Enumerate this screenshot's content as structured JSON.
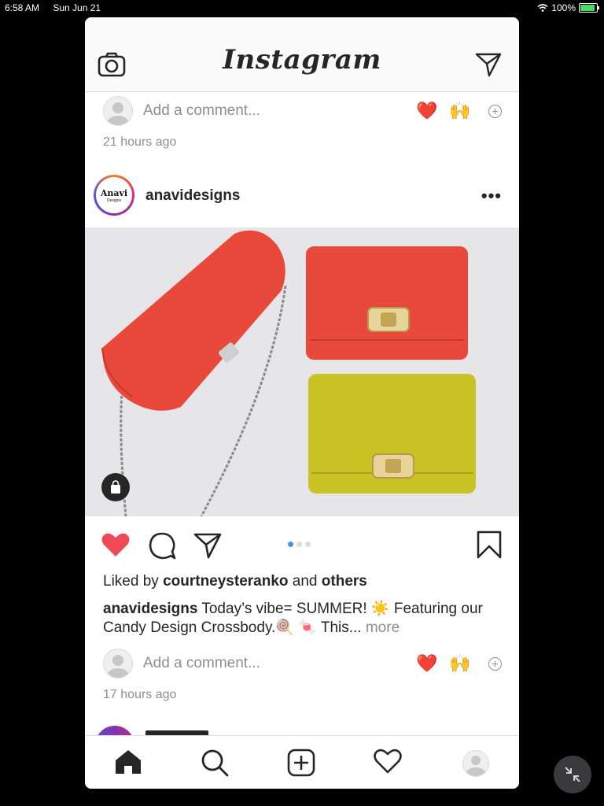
{
  "status_bar": {
    "time": "6:58 AM",
    "date": "Sun Jun 21",
    "battery": "100%",
    "battery_level": 1.0
  },
  "header": {
    "app_title": "Instagram",
    "left_icon": "camera-icon",
    "right_icon": "direct-message-icon"
  },
  "previous_post": {
    "comment_placeholder": "Add a comment...",
    "quick_reactions": [
      "❤️",
      "🙌"
    ],
    "timestamp": "21 hours ago"
  },
  "post": {
    "avatar_text": "Anavi",
    "avatar_subtext": "Designs",
    "username": "anavidesigns",
    "image_description_icon": "shopping-bag-icon",
    "carousel": {
      "count": 3,
      "active_index": 0
    },
    "liked": true,
    "likes_prefix": "Liked by",
    "liked_by_user": "courtneysteranko",
    "likes_and": "and",
    "likes_others": "others",
    "caption_user": "anavidesigns",
    "caption_text": "Today’s vibe= SUMMER! ☀️ Featuring our Candy Design Crossbody.🍭 🍬  This...",
    "caption_more": "more",
    "comment_placeholder": "Add a comment...",
    "quick_reactions": [
      "❤️",
      "🙌"
    ],
    "timestamp": "17 hours ago"
  },
  "tab_bar": {
    "items": [
      "home-icon",
      "search-icon",
      "new-post-icon",
      "activity-icon",
      "profile-avatar"
    ]
  },
  "colors": {
    "like_red": "#ed4956",
    "accent_blue": "#3897f0",
    "bag_red": "#e8493a",
    "bag_yellow": "#c9c325"
  }
}
